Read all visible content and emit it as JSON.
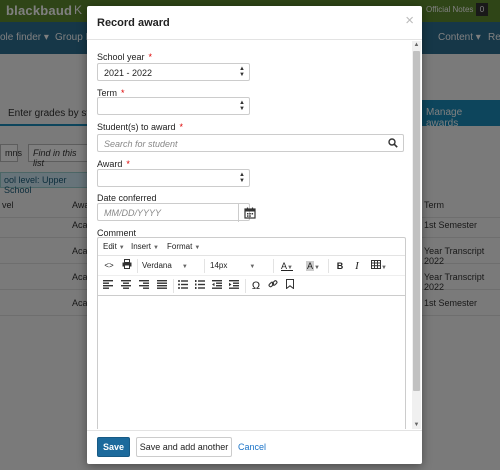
{
  "background": {
    "app_logo": "blackbaud",
    "app_name": "K",
    "official_notes": "Official Notes",
    "notes_count": "0",
    "nav_items": [
      "ole finder ▾",
      "Group Fa",
      "Content ▾",
      "Re"
    ],
    "tab_enter_grades": "Enter grades by stud",
    "tab_manage_awards": "Manage awards",
    "toolbar_columns": "mns",
    "toolbar_find": "Find in this list",
    "filter_chip": "ool level: Upper School",
    "column_headers": [
      "vel",
      "Awa",
      "Term"
    ],
    "rows": [
      {
        "c1": "Aca",
        "c2": "1st Semester"
      },
      {
        "c1": "Aca",
        "c2": "Year Transcript 2022"
      },
      {
        "c1": "Aca",
        "c2": "Year Transcript 2022"
      },
      {
        "c1": "Aca",
        "c2": "1st Semester"
      }
    ]
  },
  "modal": {
    "title": "Record award",
    "close_symbol": "×",
    "school_year": {
      "label": "School year",
      "required_mark": "*",
      "value": "2021 - 2022"
    },
    "term": {
      "label": "Term",
      "required_mark": "*",
      "value": ""
    },
    "students": {
      "label": "Student(s) to award",
      "required_mark": "*",
      "placeholder": "Search for student"
    },
    "award": {
      "label": "Award",
      "required_mark": "*",
      "value": ""
    },
    "date_conferred": {
      "label": "Date conferred",
      "placeholder": "MM/DD/YYYY"
    },
    "comment": {
      "label": "Comment",
      "menus": [
        "Edit",
        "Insert",
        "Format"
      ],
      "font_family": "Verdana",
      "font_size": "14px",
      "toolbar1_buttons": [
        "source-code",
        "print",
        "font-color",
        "highlight-color",
        "bold",
        "italic",
        "table"
      ],
      "toolbar2_buttons": [
        "align-left",
        "align-center",
        "align-right",
        "justify",
        "bulleted-list",
        "numbered-list",
        "outdent",
        "indent",
        "special-character",
        "link",
        "bookmark"
      ],
      "special_char_glyph": "Ω",
      "bold_glyph": "B",
      "italic_glyph": "I",
      "font_color_glyph": "A",
      "highlight_glyph": "A"
    },
    "buttons": {
      "save": "Save",
      "save_add": "Save and add another",
      "cancel": "Cancel"
    }
  },
  "colors": {
    "primary": "#1c6a9c",
    "link": "#1a73c8",
    "required": "#dd0000",
    "topbar": "#5f8a2e",
    "nav": "#2c6e91"
  }
}
